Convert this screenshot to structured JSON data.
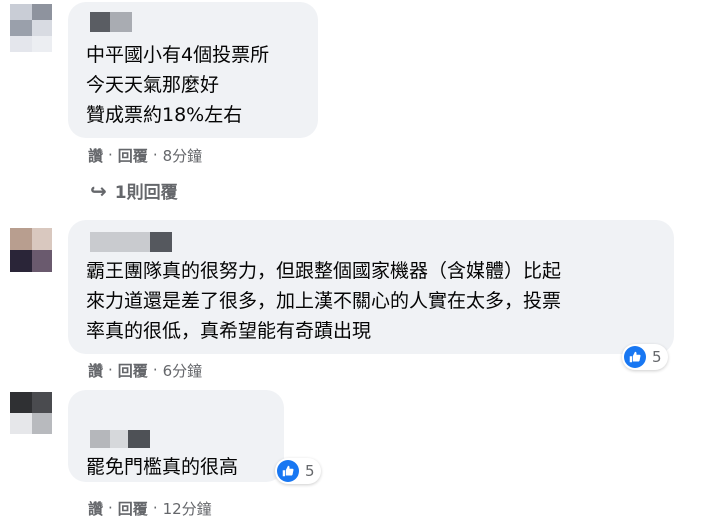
{
  "comments": [
    {
      "lines": "中平國小有4個投票所\n今天天氣那麼好\n贊成票約18%左右",
      "actions": {
        "like": "讚",
        "reply": "回覆",
        "time": "8分鐘"
      },
      "replies_label": "1則回覆"
    },
    {
      "lines": "霸王團隊真的很努力，但跟整個國家機器（含媒體）比起\n來力道還是差了很多，加上漢不關心的人實在太多，投票\n率真的很低，真希望能有奇蹟出現",
      "actions": {
        "like": "讚",
        "reply": "回覆",
        "time": "6分鐘"
      },
      "reaction_count": "5"
    },
    {
      "lines": "罷免門檻真的很高",
      "actions": {
        "like": "讚",
        "reply": "回覆",
        "time": "12分鐘"
      },
      "reaction_count": "5"
    }
  ],
  "separator": "·",
  "reply_arrow": "↪",
  "colors": {
    "bubble": "#f0f2f5",
    "meta": "#65676b",
    "like": "#1877f2"
  },
  "icons": {
    "reaction": "like-thumb-icon",
    "replies": "reply-arrow-icon"
  }
}
